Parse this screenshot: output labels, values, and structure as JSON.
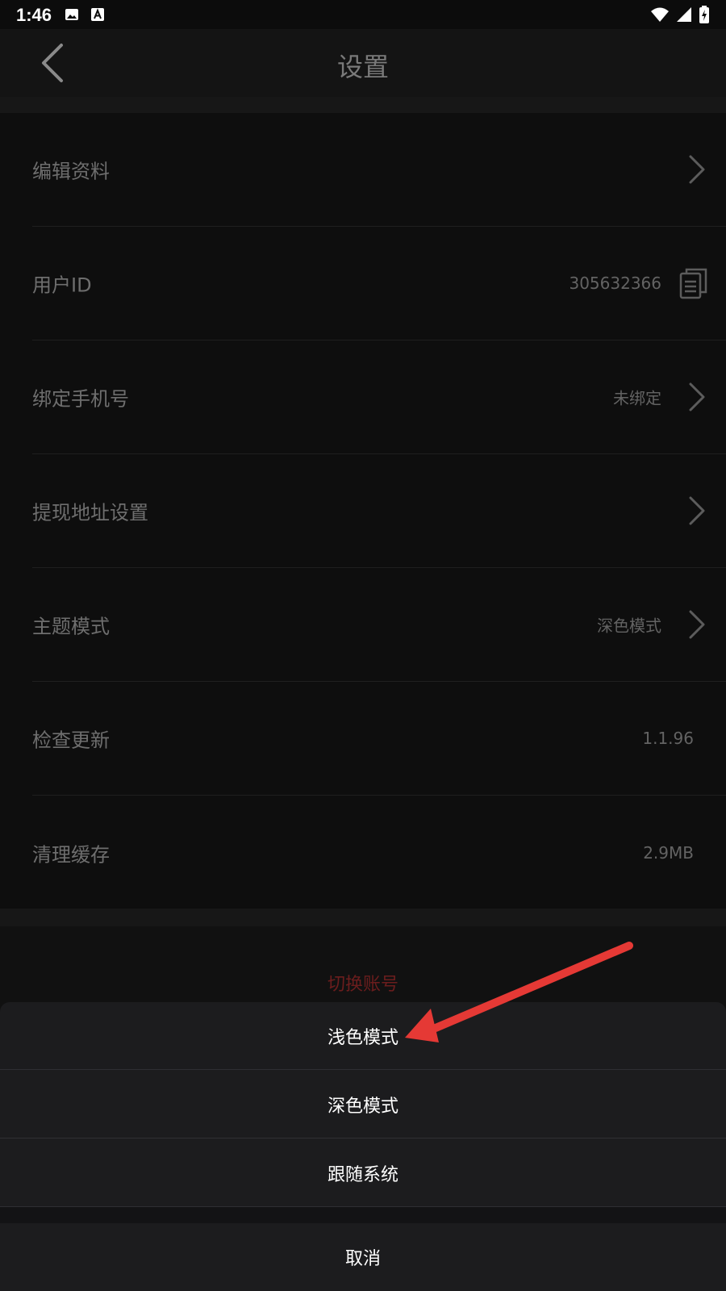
{
  "status_bar": {
    "time": "1:46",
    "left_icons": [
      "image-icon",
      "text-a-icon"
    ],
    "right_icons": [
      "wifi-icon",
      "signal-icon",
      "battery-charging-icon"
    ]
  },
  "header": {
    "title": "设置",
    "back_icon": "chevron-left-icon"
  },
  "settings": {
    "items": [
      {
        "label": "编辑资料",
        "value": "",
        "trailing": "chevron-right-icon"
      },
      {
        "label": "用户ID",
        "value": "305632366",
        "trailing": "copy-icon"
      },
      {
        "label": "绑定手机号",
        "value": "未绑定",
        "trailing": "chevron-right-icon"
      },
      {
        "label": "提现地址设置",
        "value": "",
        "trailing": "chevron-right-icon"
      },
      {
        "label": "主题模式",
        "value": "深色模式",
        "trailing": "chevron-right-icon"
      },
      {
        "label": "检查更新",
        "value": "1.1.96",
        "trailing": ""
      },
      {
        "label": "清理缓存",
        "value": "2.9MB",
        "trailing": ""
      }
    ]
  },
  "switch_account": "切换账号",
  "theme_sheet": {
    "options": [
      "浅色模式",
      "深色模式",
      "跟随系统"
    ],
    "cancel": "取消"
  },
  "annotation": {
    "arrow_color": "#e53935"
  },
  "colors": {
    "background": "#111111",
    "sheet": "#1c1c1e",
    "switch_account_text": "#6b1d1d"
  }
}
